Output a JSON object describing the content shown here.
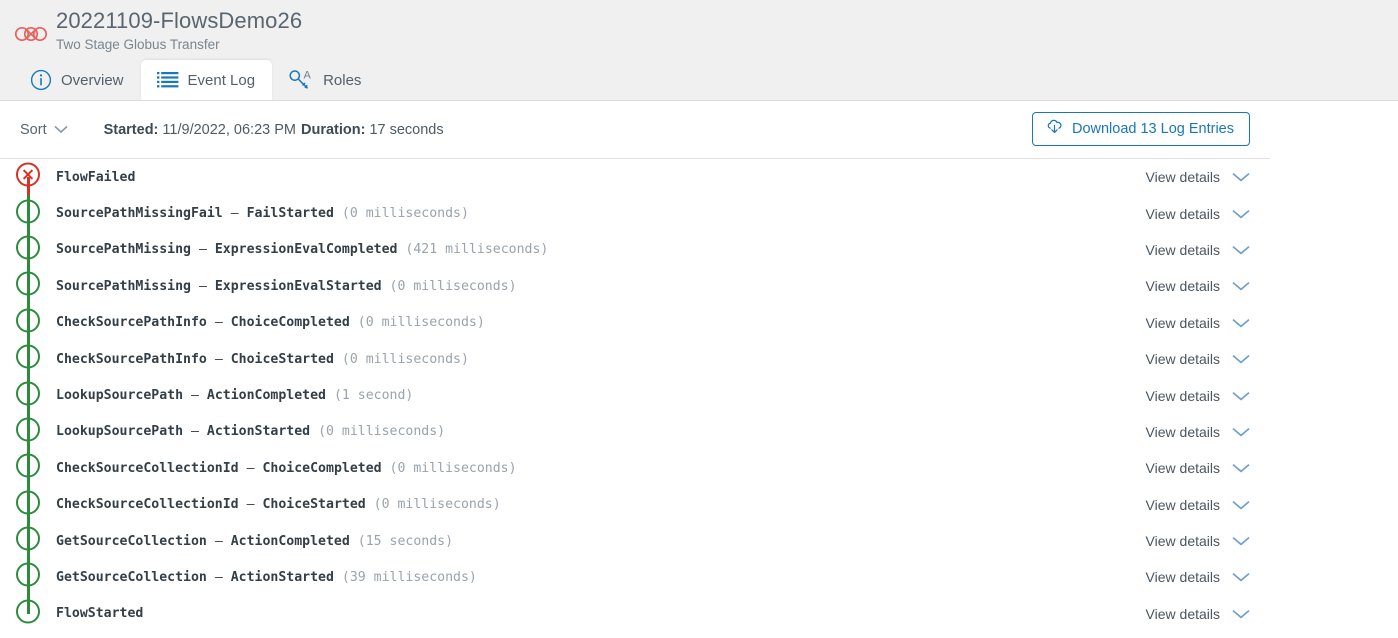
{
  "header": {
    "logo_icon": "globus-logo-icon",
    "title": "20221109-FlowsDemo26",
    "subtitle": "Two Stage Globus Transfer",
    "tabs": [
      {
        "id": "overview",
        "label": "Overview",
        "icon": "info-circle-icon",
        "active": false
      },
      {
        "id": "event-log",
        "label": "Event Log",
        "icon": "list-lines-icon",
        "active": true
      },
      {
        "id": "roles",
        "label": "Roles",
        "icon": "key-icon",
        "active": false
      }
    ]
  },
  "toolbar": {
    "sort_label": "Sort",
    "sort_icon": "chevron-down-icon",
    "started_label": "Started:",
    "started_value": "11/9/2022, 06:23 PM",
    "duration_label": "Duration:",
    "duration_value": "17 seconds",
    "download_label": "Download 13 Log Entries",
    "download_icon": "cloud-download-icon"
  },
  "log": {
    "view_details_label": "View details",
    "view_details_icon": "chevron-down-icon",
    "entries": [
      {
        "status": "failed",
        "step": "",
        "dash": "",
        "event": "FlowFailed",
        "duration": ""
      },
      {
        "status": "ok",
        "step": "SourcePathMissingFail",
        "dash": "–",
        "event": "FailStarted",
        "duration": "(0 milliseconds)"
      },
      {
        "status": "ok",
        "step": "SourcePathMissing",
        "dash": "–",
        "event": "ExpressionEvalCompleted",
        "duration": "(421 milliseconds)"
      },
      {
        "status": "ok",
        "step": "SourcePathMissing",
        "dash": "–",
        "event": "ExpressionEvalStarted",
        "duration": "(0 milliseconds)"
      },
      {
        "status": "ok",
        "step": "CheckSourcePathInfo",
        "dash": "–",
        "event": "ChoiceCompleted",
        "duration": "(0 milliseconds)"
      },
      {
        "status": "ok",
        "step": "CheckSourcePathInfo",
        "dash": "–",
        "event": "ChoiceStarted",
        "duration": "(0 milliseconds)"
      },
      {
        "status": "ok",
        "step": "LookupSourcePath",
        "dash": "–",
        "event": "ActionCompleted",
        "duration": "(1 second)"
      },
      {
        "status": "ok",
        "step": "LookupSourcePath",
        "dash": "–",
        "event": "ActionStarted",
        "duration": "(0 milliseconds)"
      },
      {
        "status": "ok",
        "step": "CheckSourceCollectionId",
        "dash": "–",
        "event": "ChoiceCompleted",
        "duration": "(0 milliseconds)"
      },
      {
        "status": "ok",
        "step": "CheckSourceCollectionId",
        "dash": "–",
        "event": "ChoiceStarted",
        "duration": "(0 milliseconds)"
      },
      {
        "status": "ok",
        "step": "GetSourceCollection",
        "dash": "–",
        "event": "ActionCompleted",
        "duration": "(15 seconds)"
      },
      {
        "status": "ok",
        "step": "GetSourceCollection",
        "dash": "–",
        "event": "ActionStarted",
        "duration": "(39 milliseconds)"
      },
      {
        "status": "start",
        "step": "",
        "dash": "",
        "event": "FlowStarted",
        "duration": ""
      }
    ]
  },
  "colors": {
    "accent_blue": "#1878b9",
    "success_green": "#2e8b3d",
    "error_red": "#d93025",
    "header_bg": "#f0f0f0",
    "logo_red": "#e8615a"
  }
}
